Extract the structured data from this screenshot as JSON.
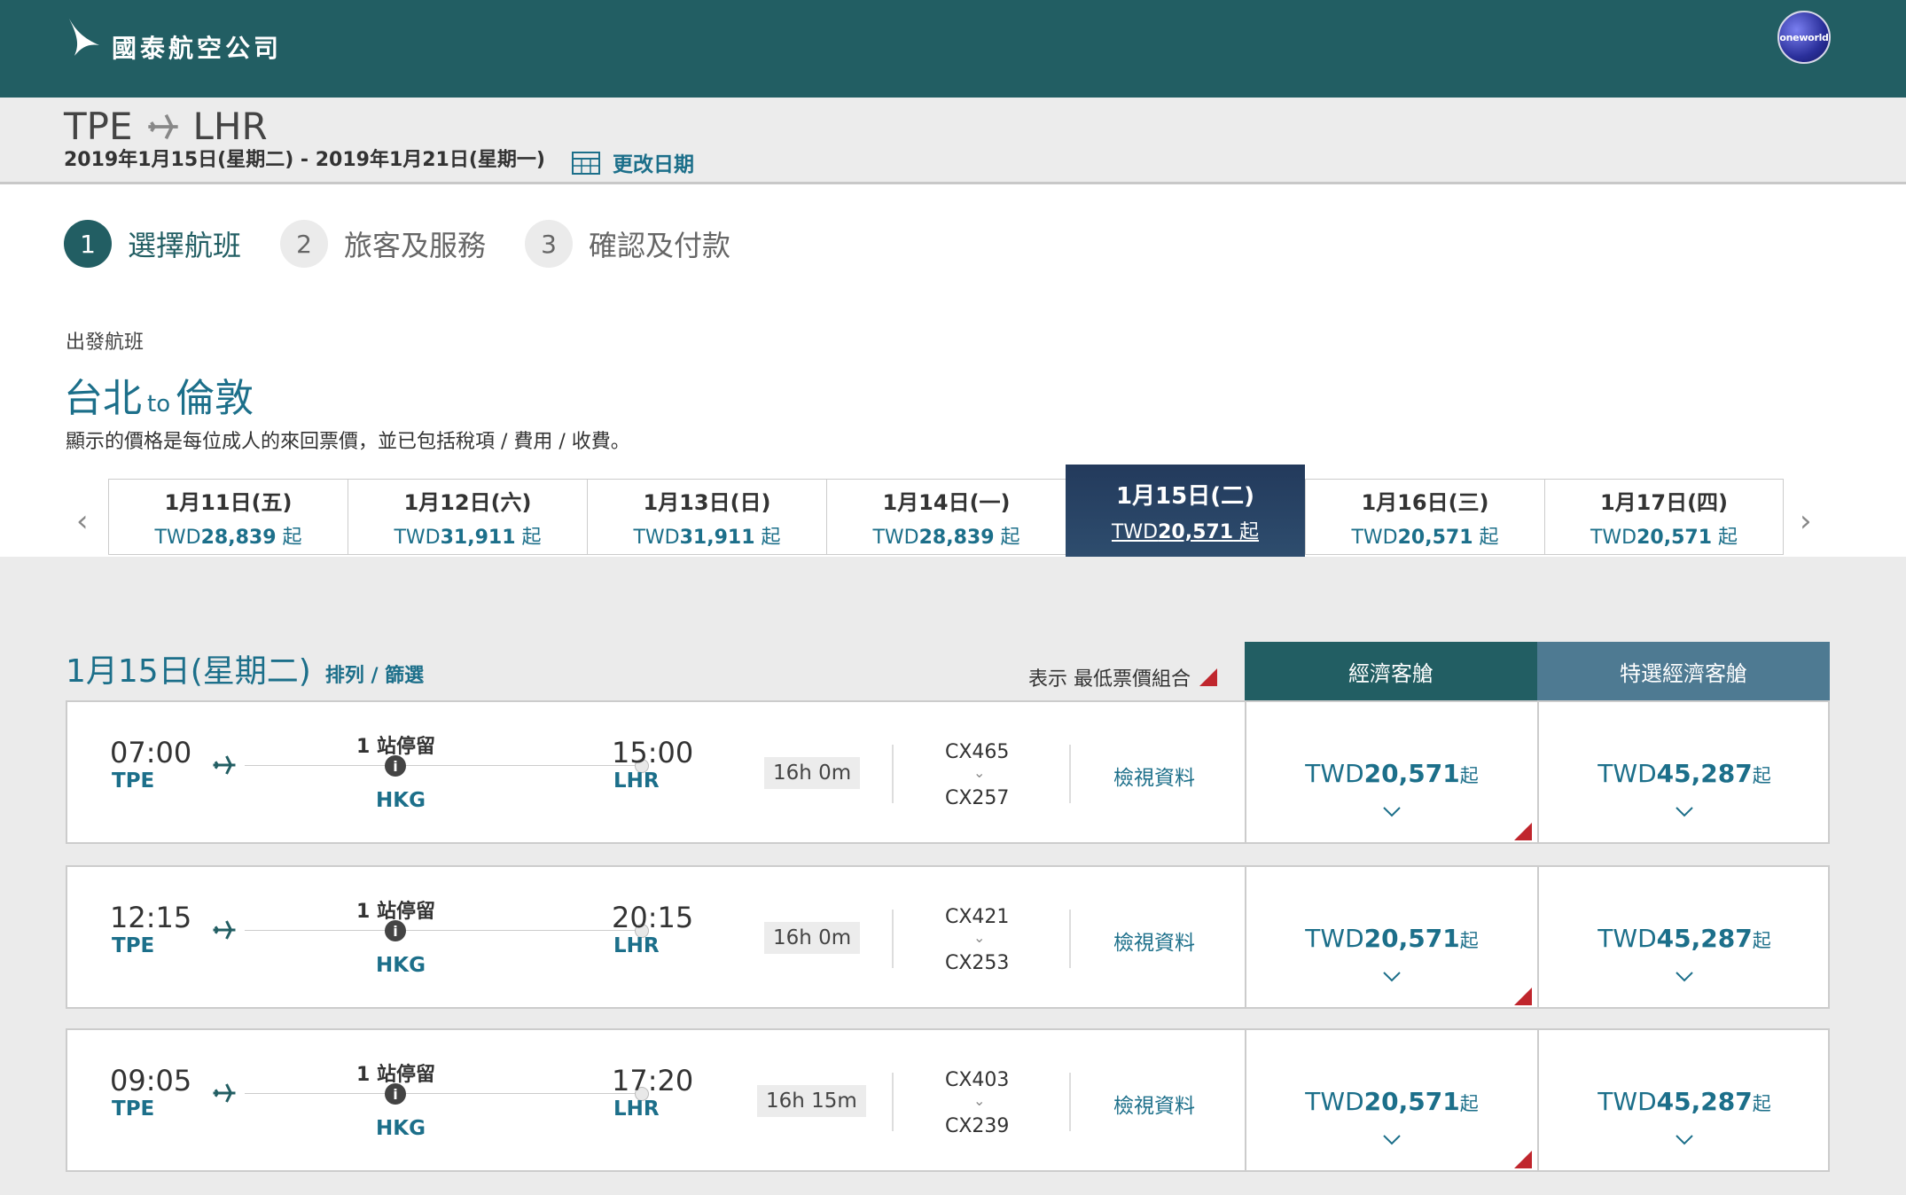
{
  "brand": {
    "name": "國泰航空公司",
    "alliance": "oneworld"
  },
  "route": {
    "origin": "TPE",
    "destination": "LHR",
    "dates": "2019年1月15日(星期二) - 2019年1月21日(星期一)",
    "change_date_label": "更改日期"
  },
  "steps": [
    {
      "num": "1",
      "label": "選擇航班"
    },
    {
      "num": "2",
      "label": "旅客及服務"
    },
    {
      "num": "3",
      "label": "確認及付款"
    }
  ],
  "section": {
    "label": "出發航班",
    "from_city": "台北",
    "to_word": "to",
    "to_city": "倫敦",
    "price_note": "顯示的價格是每位成人的來回票價，並已包括稅項 / 費用 / 收費。"
  },
  "date_strip": [
    {
      "date": "1月11日(五)",
      "currency": "TWD",
      "price": "28,839",
      "suffix": "起"
    },
    {
      "date": "1月12日(六)",
      "currency": "TWD",
      "price": "31,911",
      "suffix": "起"
    },
    {
      "date": "1月13日(日)",
      "currency": "TWD",
      "price": "31,911",
      "suffix": "起"
    },
    {
      "date": "1月14日(一)",
      "currency": "TWD",
      "price": "28,839",
      "suffix": "起"
    },
    {
      "date": "1月15日(二)",
      "currency": "TWD",
      "price": "20,571",
      "suffix": "起"
    },
    {
      "date": "1月16日(三)",
      "currency": "TWD",
      "price": "20,571",
      "suffix": "起"
    },
    {
      "date": "1月17日(四)",
      "currency": "TWD",
      "price": "20,571",
      "suffix": "起"
    }
  ],
  "results": {
    "date": "1月15日(星期二)",
    "sort_filter": "排列 / 篩選",
    "show_lowest": "表示 最低票價組合",
    "cabins": [
      "經濟客艙",
      "特選經濟客艙"
    ]
  },
  "flights": [
    {
      "dep_time": "07:00",
      "dep_code": "TPE",
      "stops": "1 站停留",
      "via": "HKG",
      "arr_time": "15:00",
      "arr_code": "LHR",
      "duration": "16h 0m",
      "flight1": "CX465",
      "flight2": "CX257",
      "details": "檢視資料",
      "eco_cur": "TWD",
      "eco_price": "20,571",
      "prem_cur": "TWD",
      "prem_price": "45,287",
      "suffix": "起"
    },
    {
      "dep_time": "12:15",
      "dep_code": "TPE",
      "stops": "1 站停留",
      "via": "HKG",
      "arr_time": "20:15",
      "arr_code": "LHR",
      "duration": "16h 0m",
      "flight1": "CX421",
      "flight2": "CX253",
      "details": "檢視資料",
      "eco_cur": "TWD",
      "eco_price": "20,571",
      "prem_cur": "TWD",
      "prem_price": "45,287",
      "suffix": "起"
    },
    {
      "dep_time": "09:05",
      "dep_code": "TPE",
      "stops": "1 站停留",
      "via": "HKG",
      "arr_time": "17:20",
      "arr_code": "LHR",
      "duration": "16h 15m",
      "flight1": "CX403",
      "flight2": "CX239",
      "details": "檢視資料",
      "eco_cur": "TWD",
      "eco_price": "20,571",
      "prem_cur": "TWD",
      "prem_price": "45,287",
      "suffix": "起"
    }
  ]
}
